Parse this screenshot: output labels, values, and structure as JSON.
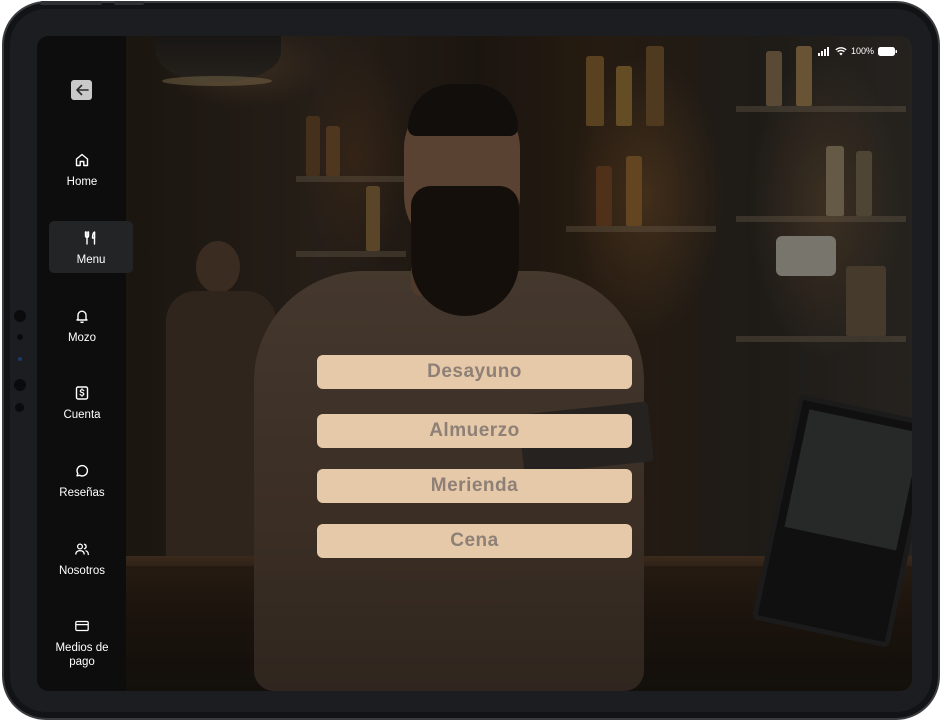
{
  "status_bar": {
    "battery_percent": "100%",
    "signal_icon": "cellular-signal-icon",
    "wifi_icon": "wifi-icon",
    "battery_icon": "battery-icon"
  },
  "sidebar": {
    "back_icon": "arrow-left-icon",
    "items": [
      {
        "label": "Home",
        "icon": "home-icon",
        "active": false
      },
      {
        "label": "Menu",
        "icon": "utensils-icon",
        "active": true
      },
      {
        "label": "Mozo",
        "icon": "bell-icon",
        "active": false
      },
      {
        "label": "Cuenta",
        "icon": "dollar-receipt-icon",
        "active": false
      },
      {
        "label": "Reseñas",
        "icon": "chat-bubble-icon",
        "active": false
      },
      {
        "label": "Nosotros",
        "icon": "users-icon",
        "active": false
      },
      {
        "label": "Medios de pago",
        "icon": "credit-card-icon",
        "active": false
      }
    ]
  },
  "menu": {
    "options": [
      {
        "label": "Desayuno"
      },
      {
        "label": "Almuerzo"
      },
      {
        "label": "Merienda"
      },
      {
        "label": "Cena"
      }
    ]
  },
  "colors": {
    "button_bg": "#e6c9a8",
    "button_text": "#8e8077",
    "sidebar_bg": "#0d0d0e",
    "active_item_bg": "#232426"
  }
}
